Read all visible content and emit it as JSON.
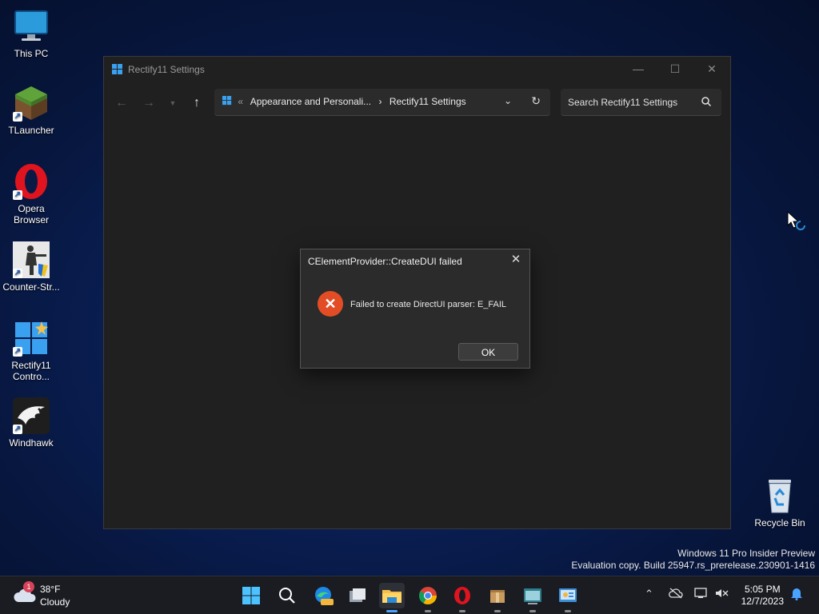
{
  "desktop": {
    "icons": [
      {
        "label": "This PC"
      },
      {
        "label": "TLauncher"
      },
      {
        "label": "Opera Browser"
      },
      {
        "label": "Counter-Str..."
      },
      {
        "label": "Rectify11 Contro..."
      },
      {
        "label": "Windhawk"
      },
      {
        "label": "Recycle Bin"
      }
    ]
  },
  "window": {
    "title": "Rectify11 Settings",
    "breadcrumb": [
      "Appearance and Personali...",
      "Rectify11 Settings"
    ],
    "search_placeholder": "Search Rectify11 Settings"
  },
  "dialog": {
    "title": "CElementProvider::CreateDUI failed",
    "message": "Failed to create DirectUI parser: E_FAIL",
    "ok_label": "OK"
  },
  "watermark": {
    "line1": "Windows 11 Pro Insider Preview",
    "line2": "Evaluation copy. Build 25947.rs_prerelease.230901-1416"
  },
  "taskbar": {
    "weather": {
      "temp": "38°F",
      "condition": "Cloudy",
      "badge": "1"
    },
    "clock": {
      "time": "5:05 PM",
      "date": "12/7/2023"
    }
  },
  "colors": {
    "accent": "#4aa3ff",
    "error": "#e24d25",
    "window_bg": "#202020",
    "dialog_bg": "#2b2b2b"
  }
}
